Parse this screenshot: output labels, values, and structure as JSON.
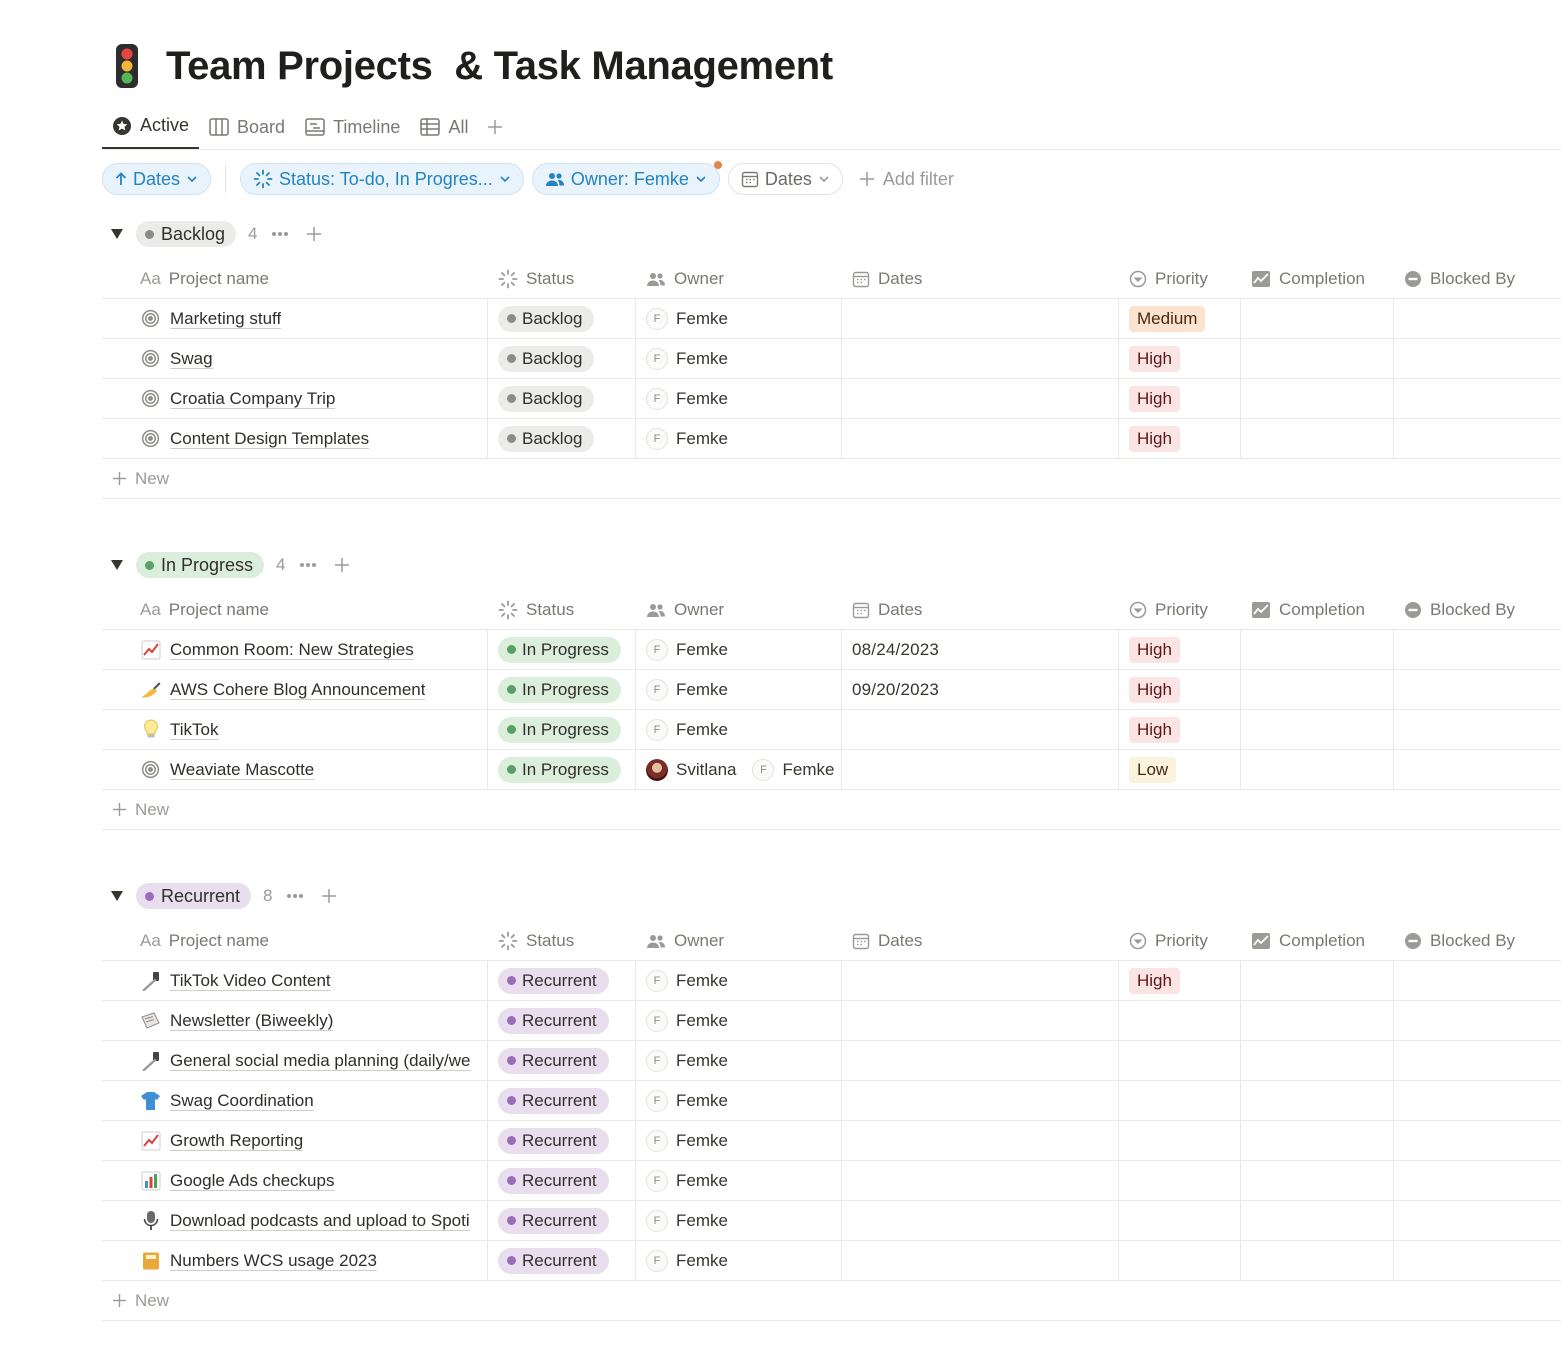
{
  "page": {
    "title": "Team Projects  & Task Management",
    "title_icon": "traffic-light-icon"
  },
  "views": [
    {
      "label": "Active",
      "icon": "star-circle-icon",
      "active": true
    },
    {
      "label": "Board",
      "icon": "board-icon"
    },
    {
      "label": "Timeline",
      "icon": "timeline-icon"
    },
    {
      "label": "All",
      "icon": "table-icon"
    }
  ],
  "filters": {
    "sort": "Dates",
    "status": "Status: To-do, In Progres...",
    "owner": "Owner: Femke",
    "dates": "Dates",
    "add_filter": "Add filter"
  },
  "columns": {
    "name": "Project name",
    "name_prefix": "Aa",
    "status": "Status",
    "owner": "Owner",
    "dates": "Dates",
    "priority": "Priority",
    "completion": "Completion",
    "blocked": "Blocked By"
  },
  "new_label": "New",
  "groups": [
    {
      "name": "Backlog",
      "count": "4",
      "color": "#8c8b87",
      "tag_bg": "#ebebea",
      "rows": [
        {
          "icon": "target-icon",
          "name": "Marketing stuff",
          "status": "Backlog",
          "owners": [
            "Femke"
          ],
          "date": "",
          "priority": "Medium"
        },
        {
          "icon": "target-icon",
          "name": "Swag",
          "status": "Backlog",
          "owners": [
            "Femke"
          ],
          "date": "",
          "priority": "High"
        },
        {
          "icon": "target-icon",
          "name": "Croatia Company Trip",
          "status": "Backlog",
          "owners": [
            "Femke"
          ],
          "date": "",
          "priority": "High"
        },
        {
          "icon": "target-icon",
          "name": "Content Design Templates",
          "status": "Backlog",
          "owners": [
            "Femke"
          ],
          "date": "",
          "priority": "High"
        }
      ]
    },
    {
      "name": "In Progress",
      "count": "4",
      "color": "#58a066",
      "tag_bg": "#dbeddb",
      "rows": [
        {
          "icon": "chart-up-icon",
          "name": "Common Room: New Strategies",
          "status": "In Progress",
          "owners": [
            "Femke"
          ],
          "date": "08/24/2023",
          "priority": "High"
        },
        {
          "icon": "writing-hand-icon",
          "name": "AWS Cohere Blog Announcement",
          "status": "In Progress",
          "owners": [
            "Femke"
          ],
          "date": "09/20/2023",
          "priority": "High"
        },
        {
          "icon": "lightbulb-icon",
          "name": "TikTok",
          "status": "In Progress",
          "owners": [
            "Femke"
          ],
          "date": "",
          "priority": "High"
        },
        {
          "icon": "target-icon",
          "name": "Weaviate Mascotte",
          "status": "In Progress",
          "owners": [
            "Svitlana",
            "Femke"
          ],
          "date": "",
          "priority": "Low"
        }
      ]
    },
    {
      "name": "Recurrent",
      "count": "8",
      "color": "#9a6dbb",
      "tag_bg": "#e8deee",
      "rows": [
        {
          "icon": "selfie-stick-icon",
          "name": "TikTok Video Content",
          "status": "Recurrent",
          "owners": [
            "Femke"
          ],
          "date": "",
          "priority": "High"
        },
        {
          "icon": "newspaper-icon",
          "name": "Newsletter (Biweekly)",
          "status": "Recurrent",
          "owners": [
            "Femke"
          ],
          "date": "",
          "priority": ""
        },
        {
          "icon": "selfie-stick-icon",
          "name": "General social media planning (daily/we",
          "status": "Recurrent",
          "owners": [
            "Femke"
          ],
          "date": "",
          "priority": ""
        },
        {
          "icon": "tshirt-icon",
          "name": "Swag Coordination",
          "status": "Recurrent",
          "owners": [
            "Femke"
          ],
          "date": "",
          "priority": ""
        },
        {
          "icon": "chart-up-icon",
          "name": "Growth Reporting",
          "status": "Recurrent",
          "owners": [
            "Femke"
          ],
          "date": "",
          "priority": ""
        },
        {
          "icon": "bar-chart-icon",
          "name": "Google Ads checkups",
          "status": "Recurrent",
          "owners": [
            "Femke"
          ],
          "date": "",
          "priority": ""
        },
        {
          "icon": "microphone-icon",
          "name": "Download podcasts and upload to Spoti",
          "status": "Recurrent",
          "owners": [
            "Femke"
          ],
          "date": "",
          "priority": ""
        },
        {
          "icon": "notebook-icon",
          "name": "Numbers WCS usage 2023",
          "status": "Recurrent",
          "owners": [
            "Femke"
          ],
          "date": "",
          "priority": ""
        }
      ]
    }
  ]
}
